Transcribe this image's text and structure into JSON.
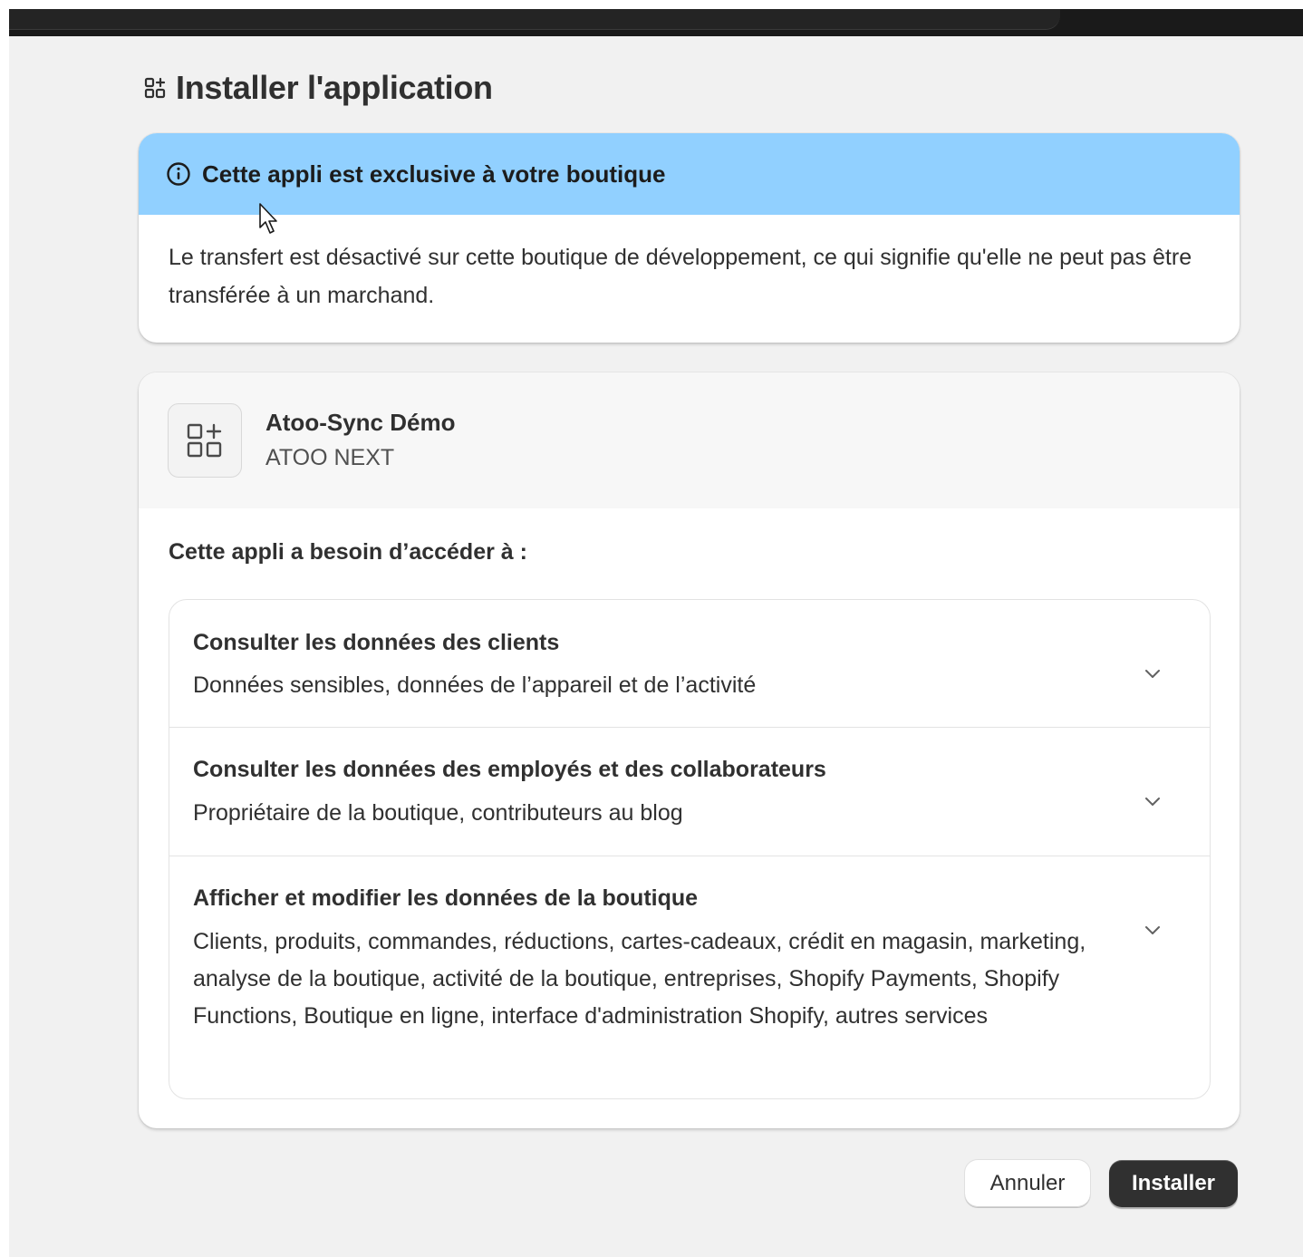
{
  "page": {
    "title": "Installer l'application"
  },
  "notice": {
    "title": "Cette appli est exclusive à votre boutique",
    "body": "Le transfert est désactivé sur cette boutique de développement, ce qui signifie qu'elle ne peut pas être transférée à un marchand.",
    "icon": "info-circle-icon",
    "color": "#91d0ff"
  },
  "app": {
    "name": "Atoo-Sync Démo",
    "developer": "ATOO NEXT",
    "icon": "apps-add-icon"
  },
  "access": {
    "label": "Cette appli a besoin d’accéder à :",
    "items": [
      {
        "title": "Consulter les données des clients",
        "description": "Données sensibles, données de l’appareil et de l’activité"
      },
      {
        "title": "Consulter les données des employés et des collaborateurs",
        "description": "Propriétaire de la boutique, contributeurs au blog"
      },
      {
        "title": "Afficher et modifier les données de la boutique",
        "description": "Clients, produits, commandes, réductions, cartes-cadeaux, crédit en magasin, marketing, analyse de la boutique, activité de la boutique, entreprises, Shopify Payments, Shopify Functions, Boutique en ligne, interface d'administration Shopify, autres services"
      }
    ]
  },
  "actions": {
    "cancel_label": "Annuler",
    "install_label": "Installer",
    "install_color": "#303030"
  }
}
